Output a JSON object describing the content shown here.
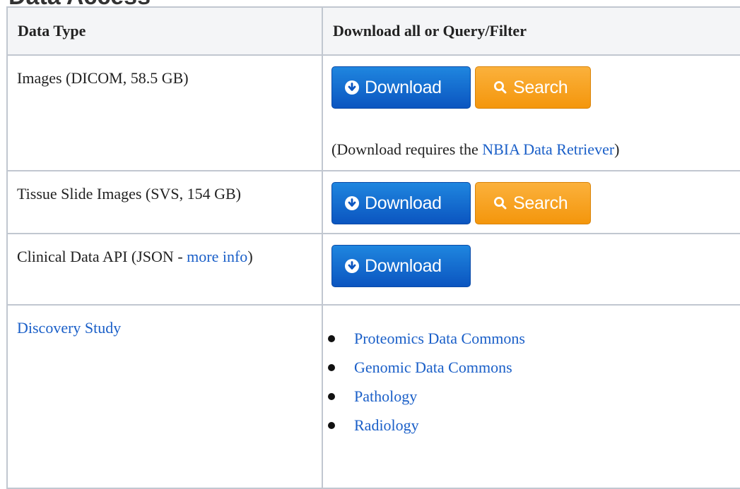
{
  "page": {
    "heading": "Data Access"
  },
  "table": {
    "headers": [
      "Data Type",
      "Download all or Query/Filter"
    ],
    "rows": {
      "images": {
        "label": "Images (DICOM, 58.5 GB)",
        "download_label": "Download",
        "search_label": "Search",
        "note_prefix": "(Download requires the ",
        "note_link": "NBIA Data Retriever",
        "note_suffix": ")"
      },
      "slides": {
        "label": "Tissue Slide Images (SVS, 154 GB)",
        "download_label": "Download",
        "search_label": "Search"
      },
      "clinical": {
        "label_prefix": "Clinical Data API (JSON - ",
        "label_link": "more info",
        "label_suffix": ")",
        "download_label": "Download"
      },
      "discovery": {
        "label": "Discovery Study",
        "links": [
          "Proteomics Data Commons",
          "Genomic Data Commons",
          "Pathology",
          "Radiology"
        ]
      }
    }
  },
  "colors": {
    "link": "#1a5fc8",
    "download_button": "#0b55c0",
    "search_button": "#f4960c",
    "header_background": "#f4f5f7",
    "border": "#c1c7d0"
  },
  "icons": {
    "download": "download-circle-icon",
    "search": "magnifier-icon",
    "bullet": "bullet-dot-icon"
  }
}
